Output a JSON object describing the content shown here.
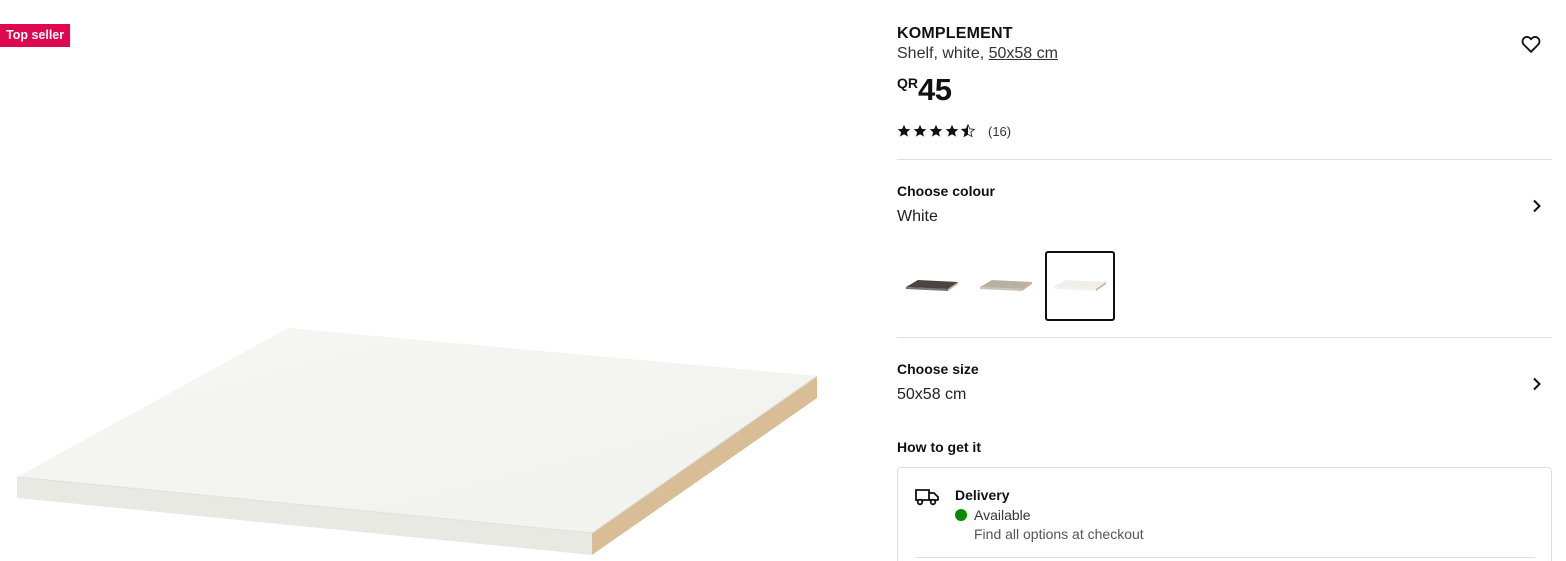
{
  "badge": {
    "label": "Top seller"
  },
  "product": {
    "name": "KOMPLEMENT",
    "description_prefix": "Shelf, white, ",
    "size_link": "50x58 cm",
    "currency": "QR",
    "price": "45",
    "rating": {
      "value": 4.5,
      "max": 5,
      "count": "(16)"
    }
  },
  "colour": {
    "title": "Choose colour",
    "selected": "White",
    "swatches": [
      {
        "name": "dark",
        "color": "#4a4542"
      },
      {
        "name": "beige",
        "color": "#b9b0a4"
      },
      {
        "name": "white",
        "color": "#f0efea",
        "selected": true
      }
    ]
  },
  "size": {
    "title": "Choose size",
    "selected": "50x58 cm"
  },
  "how_to_get": {
    "title": "How to get it",
    "delivery": {
      "title": "Delivery",
      "status": "Available",
      "status_color": "#0a8a00",
      "note": "Find all options at checkout"
    }
  },
  "colors": {
    "badge": "#e00751",
    "text": "#111111",
    "divider": "#dfdfdf"
  }
}
